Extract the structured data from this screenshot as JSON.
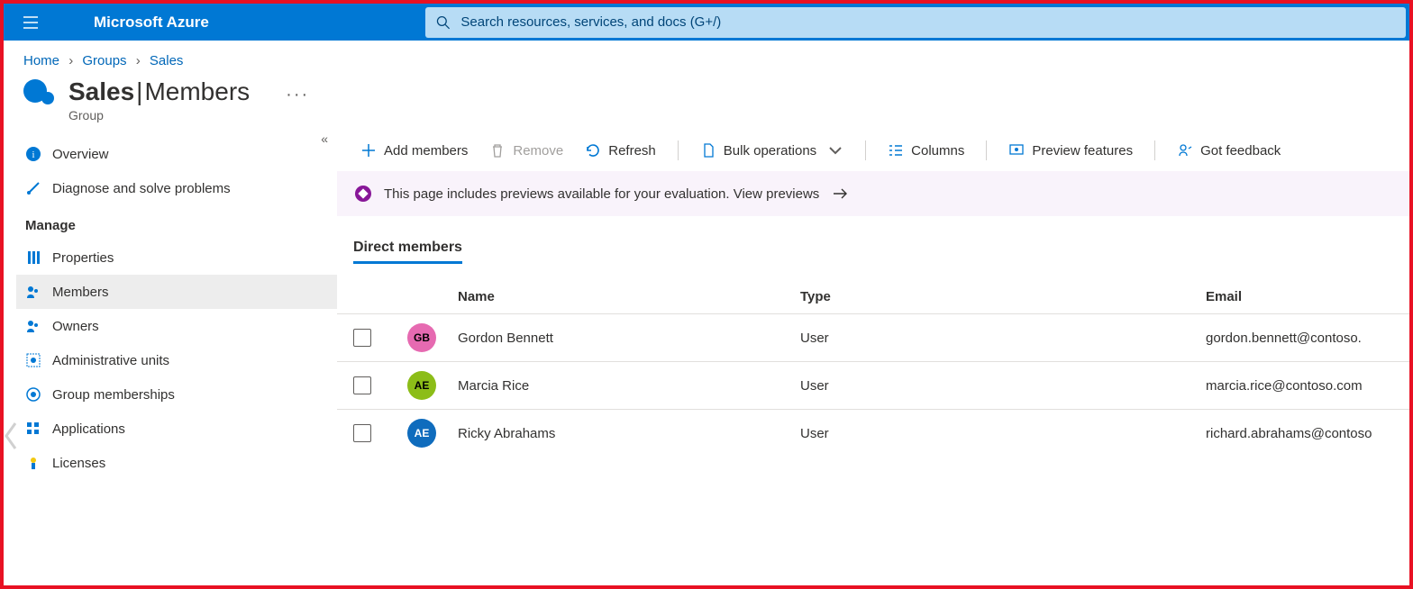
{
  "brand": "Microsoft Azure",
  "search": {
    "placeholder": "Search resources, services, and docs (G+/)"
  },
  "breadcrumb": {
    "home": "Home",
    "groups": "Groups",
    "sales": "Sales",
    "sep": "›"
  },
  "header": {
    "title_bold": "Sales",
    "title_sep": " | ",
    "title_light": "Members",
    "subtitle": "Group",
    "dots": "···"
  },
  "sidebar": {
    "collapse": "«",
    "overview": "Overview",
    "diagnose": "Diagnose and solve problems",
    "manage": "Manage",
    "properties": "Properties",
    "members": "Members",
    "owners": "Owners",
    "admin_units": "Administrative units",
    "group_memberships": "Group memberships",
    "applications": "Applications",
    "licenses": "Licenses"
  },
  "toolbar": {
    "add": "Add members",
    "remove": "Remove",
    "refresh": "Refresh",
    "bulk": "Bulk operations",
    "columns": "Columns",
    "preview": "Preview features",
    "feedback": "Got feedback"
  },
  "banner": {
    "text": "This page includes previews available for your evaluation. View previews"
  },
  "tabs": {
    "direct": "Direct members"
  },
  "table": {
    "col_name": "Name",
    "col_type": "Type",
    "col_email": "Email",
    "rows": [
      {
        "initials": "GB",
        "color": "#e66ab1",
        "name": "Gordon Bennett",
        "type": "User",
        "email": "gordon.bennett@contoso."
      },
      {
        "initials": "AE",
        "color": "#8cbd18",
        "name": "Marcia Rice",
        "type": "User",
        "email": "marcia.rice@contoso.com"
      },
      {
        "initials": "AE",
        "color": "#0f6cbd",
        "name": "Ricky Abrahams",
        "type": "User",
        "email": "richard.abrahams@contoso"
      }
    ]
  }
}
